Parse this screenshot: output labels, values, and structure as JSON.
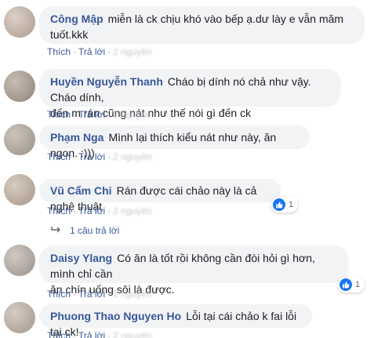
{
  "comments": [
    {
      "author": "Công Mập",
      "text": "miễn là ck chịu khó vào bếp ạ.dư lày e vẫn măm",
      "text_line2": "tuốt.kkk",
      "actions": {
        "like": "Thích",
        "reply": "Trả lời",
        "time": "2 nguyên"
      }
    },
    {
      "author": "Huyền Nguyễn Thanh",
      "text": "Cháo bị dính nó chả như vậy. Cháo dính,",
      "text_line2": "đến m rán cũng nát như thế nói gì đến ck",
      "actions": {
        "like": "Thích",
        "reply": "Trả lời",
        "time": "2 nguyên"
      }
    },
    {
      "author": "Phạm Nga",
      "text": "Mình lại thích kiểu nát như này, ăn ngon. :)))",
      "actions": {
        "like": "Thích",
        "reply": "Trả lời",
        "time": "2 nguyên"
      }
    },
    {
      "author": "Vũ Cẩm Chi",
      "text": "Rán được cái chảo này là cả nghệ thuật",
      "actions": {
        "like": "Thích",
        "reply": "Trả lời",
        "time": "2 nguyên"
      },
      "reaction": {
        "icon": "like-icon",
        "count": "1"
      },
      "replies": "1 câu trả lời"
    },
    {
      "author": "Daisy Ylang",
      "text": "Có ăn là tốt rồi không cần đòi hỏi gì hơn, mình chỉ cần",
      "text_line2": "ăn chín uống sôi là được.",
      "actions": {
        "like": "Thích",
        "reply": "Trả lời",
        "time": "2 nguyên"
      },
      "reaction": {
        "icon": "like-icon",
        "count": "1"
      }
    },
    {
      "author": "Phuong Thao Nguyen Ho",
      "text": "Lỗi tại cái chảo k fai lỗi tại ck!",
      "actions": {
        "like": "Thích",
        "reply": "Trả lời",
        "time": "2 nguyên"
      }
    }
  ],
  "colors": {
    "author": "#385898",
    "bubble": "#f2f3f5",
    "like": "#1877f2"
  }
}
